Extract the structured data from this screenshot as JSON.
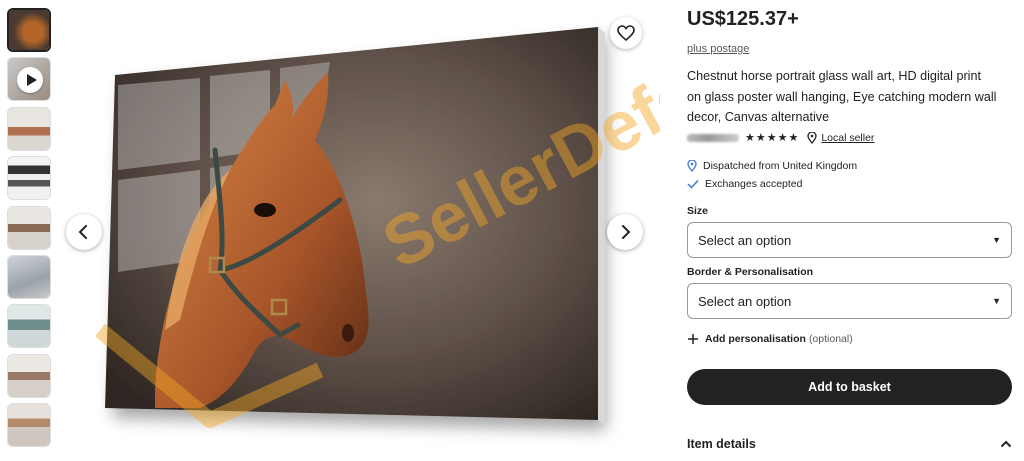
{
  "gallery": {
    "thumbnails": [
      {
        "kind": "image",
        "active": true
      },
      {
        "kind": "video"
      },
      {
        "kind": "image"
      },
      {
        "kind": "image"
      },
      {
        "kind": "image"
      },
      {
        "kind": "image"
      },
      {
        "kind": "image"
      },
      {
        "kind": "image"
      },
      {
        "kind": "image"
      }
    ],
    "prev_icon": "chevron-left-icon",
    "next_icon": "chevron-right-icon",
    "favorite_icon": "heart-icon",
    "watermark": "SellerDefense"
  },
  "product": {
    "price": "US$125.37+",
    "postage": "plus postage",
    "title": "Chestnut horse portrait glass wall art, HD digital print on glass poster wall hanging, Eye catching modern wall decor, Canvas alternative",
    "stars": "★★★★★",
    "local_seller": "Local seller",
    "dispatched": "Dispatched from United Kingdom",
    "exchanges": "Exchanges accepted"
  },
  "options": {
    "size_label": "Size",
    "size_value": "Select an option",
    "border_label": "Border & Personalisation",
    "border_value": "Select an option",
    "add_personalisation": "Add personalisation",
    "optional": "(optional)"
  },
  "actions": {
    "add_to_basket": "Add to basket",
    "item_details": "Item details"
  },
  "colors": {
    "button_dark": "#222222",
    "watermark": "#f5a623"
  }
}
